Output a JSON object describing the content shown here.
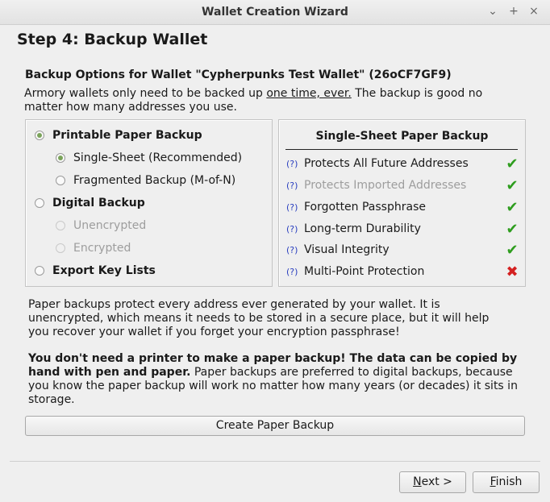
{
  "window": {
    "title": "Wallet Creation Wizard",
    "controls": {
      "minimize": "⌄",
      "maximize": "+",
      "close": "×"
    }
  },
  "step_title": "Step 4: Backup Wallet",
  "options_title": "Backup Options for Wallet \"Cypherpunks Test Wallet\" (26oCF7GF9)",
  "intro": {
    "before": "Armory wallets only need to be backed up ",
    "underlined": "one time, ever.",
    "after": " The backup is good no matter how many addresses you use."
  },
  "options": {
    "printable": {
      "label": "Printable Paper Backup",
      "checked": true
    },
    "single_sheet": {
      "label": "Single-Sheet (Recommended)",
      "checked": true
    },
    "fragmented": {
      "label": "Fragmented Backup (M-of-N)",
      "checked": false
    },
    "digital": {
      "label": "Digital Backup",
      "checked": false
    },
    "unencrypted": {
      "label": "Unencrypted",
      "disabled": true
    },
    "encrypted": {
      "label": "Encrypted",
      "disabled": true
    },
    "export_keys": {
      "label": "Export Key Lists",
      "checked": false
    }
  },
  "features": {
    "title": "Single-Sheet Paper Backup",
    "help": "(?)",
    "items": [
      {
        "label": "Protects All Future Addresses",
        "supported": true,
        "disabled": false
      },
      {
        "label": "Protects Imported Addresses",
        "supported": true,
        "disabled": true
      },
      {
        "label": "Forgotten Passphrase",
        "supported": true,
        "disabled": false
      },
      {
        "label": "Long-term Durability",
        "supported": true,
        "disabled": false
      },
      {
        "label": "Visual Integrity",
        "supported": true,
        "disabled": false
      },
      {
        "label": "Multi-Point Protection",
        "supported": false,
        "disabled": false
      }
    ]
  },
  "description": "Paper backups protect every address ever generated by your wallet. It is unencrypted, which means it needs to be stored in a secure place, but it will help you recover your wallet if you forget your encryption passphrase!",
  "description2": {
    "bold": "You don't need a printer to make a paper backup! The data can be copied by hand with pen and paper.",
    "normal": " Paper backups are preferred to digital backups, because you know the paper backup will work no matter how many years (or decades) it sits in storage."
  },
  "buttons": {
    "create": "Create Paper Backup",
    "next_mnemonic": "N",
    "next_rest": "ext >",
    "finish_mnemonic": "F",
    "finish_rest": "inish"
  },
  "colors": {
    "check": "#2e9d1e",
    "cross": "#d42121",
    "help": "#2a3fbf",
    "radio_fill": "#7aa35a"
  }
}
